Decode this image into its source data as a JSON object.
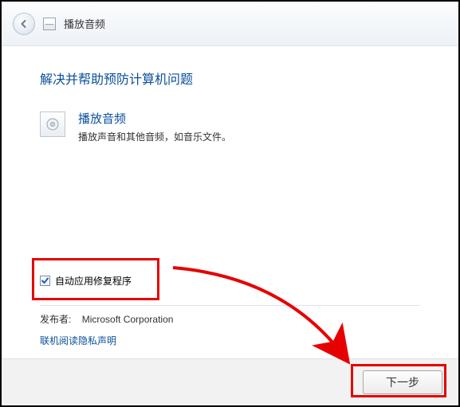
{
  "window": {
    "title": "播放音频"
  },
  "page": {
    "heading": "解决并帮助预防计算机问题"
  },
  "section": {
    "title": "播放音频",
    "desc": "播放声音和其他音频，如音乐文件。"
  },
  "auto_repair": {
    "checkbox_label": "自动应用修复程序",
    "checked": true
  },
  "publisher": {
    "label": "发布者:",
    "name": "Microsoft Corporation"
  },
  "privacy_link": "联机阅读隐私声明",
  "buttons": {
    "next": "下一步"
  }
}
